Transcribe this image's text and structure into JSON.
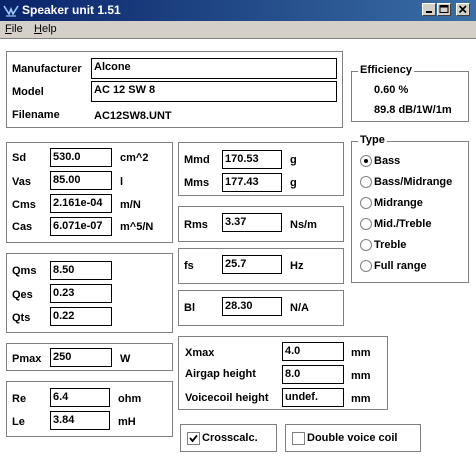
{
  "window": {
    "title": "Speaker unit 1.51",
    "min_label": "minimize",
    "max_label": "maximize",
    "close_label": "close"
  },
  "menu": {
    "file": "File",
    "help": "Help"
  },
  "ident": {
    "manufacturer_label": "Manufacturer",
    "manufacturer": "Alcone",
    "model_label": "Model",
    "model": "AC 12 SW 8",
    "filename_label": "Filename",
    "filename": "AC12SW8.UNT"
  },
  "efficiency": {
    "title": "Efficiency",
    "percent": "0.60 %",
    "spl": "89.8 dB/1W/1m"
  },
  "type": {
    "title": "Type",
    "options": [
      "Bass",
      "Bass/Midrange",
      "Midrange",
      "Mid./Treble",
      "Treble",
      "Full range"
    ],
    "selected": "Bass"
  },
  "mech": {
    "sd_label": "Sd",
    "sd": "530.0",
    "sd_unit": "cm^2",
    "vas_label": "Vas",
    "vas": "85.00",
    "vas_unit": "l",
    "cms_label": "Cms",
    "cms": "2.161e-04",
    "cms_unit": "m/N",
    "cas_label": "Cas",
    "cas": "6.071e-07",
    "cas_unit": "m^5/N"
  },
  "mass": {
    "mmd_label": "Mmd",
    "mmd": "170.53",
    "mmd_unit": "g",
    "mms_label": "Mms",
    "mms": "177.43",
    "mms_unit": "g"
  },
  "rms": {
    "label": "Rms",
    "value": "3.37",
    "unit": "Ns/m"
  },
  "q": {
    "qms_label": "Qms",
    "qms": "8.50",
    "qes_label": "Qes",
    "qes": "0.23",
    "qts_label": "Qts",
    "qts": "0.22"
  },
  "fs": {
    "label": "fs",
    "value": "25.7",
    "unit": "Hz"
  },
  "bl": {
    "label": "Bl",
    "value": "28.30",
    "unit": "N/A"
  },
  "pmax": {
    "label": "Pmax",
    "value": "250",
    "unit": "W"
  },
  "elec": {
    "re_label": "Re",
    "re": "6.4",
    "re_unit": "ohm",
    "le_label": "Le",
    "le": "3.84",
    "le_unit": "mH"
  },
  "geom": {
    "xmax_label": "Xmax",
    "xmax": "4.0",
    "xmax_unit": "mm",
    "airgap_label": "Airgap height",
    "airgap": "8.0",
    "airgap_unit": "mm",
    "voicecoil_label": "Voicecoil height",
    "voicecoil": "undef.",
    "voicecoil_unit": "mm"
  },
  "crosscalc": {
    "label": "Crosscalc.",
    "checked": true
  },
  "double_voice_coil": {
    "label": "Double voice coil",
    "checked": false
  }
}
